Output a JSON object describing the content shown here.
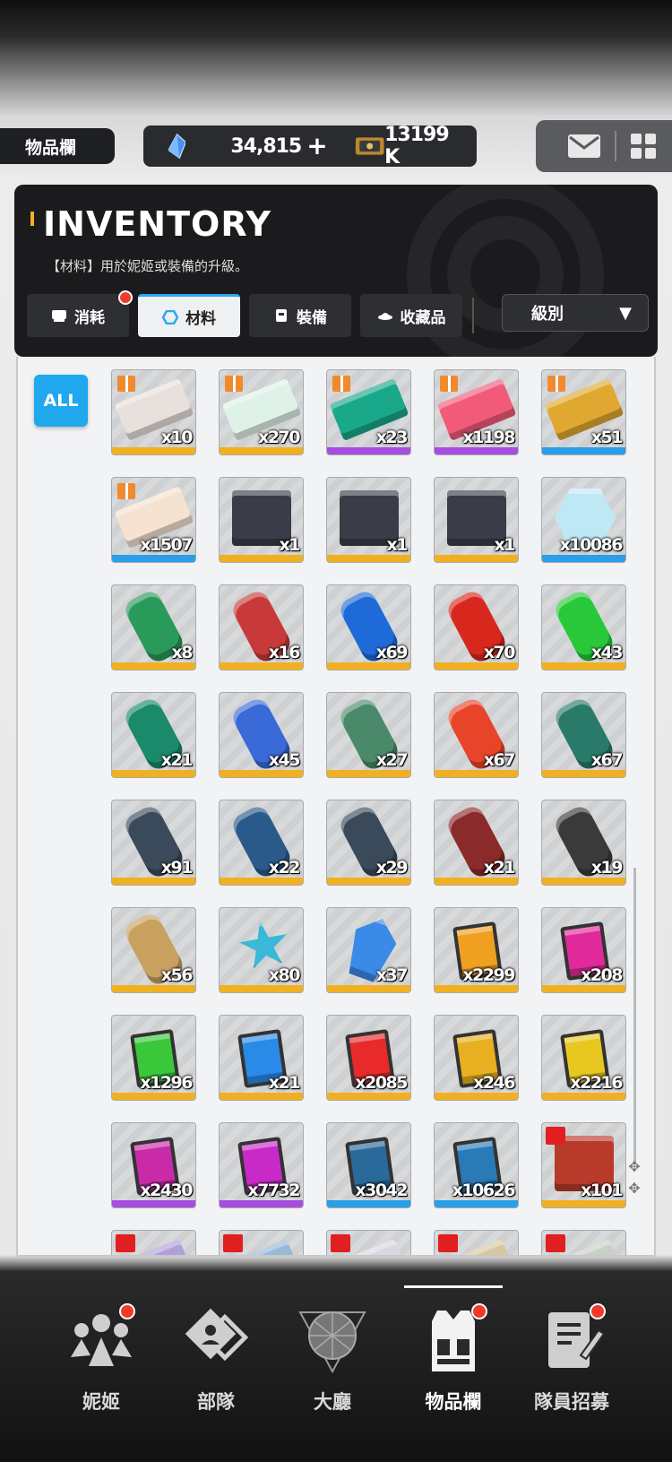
{
  "topbar": {
    "page_tag": "物品欄",
    "gem_value": "34,815",
    "plus_label": "+",
    "ticket_value": "13199 K",
    "icons": [
      "gem-icon",
      "ticket-icon",
      "mail-icon",
      "grid-menu-icon"
    ]
  },
  "header": {
    "title": "INVENTORY",
    "subtitle": "【材料】用於妮姬或裝備的升級。",
    "tabs": [
      {
        "label": "消耗",
        "icon": "consumable-icon",
        "badge": true,
        "active": false
      },
      {
        "label": "材料",
        "icon": "hexagon-icon",
        "badge": false,
        "active": true
      },
      {
        "label": "裝備",
        "icon": "armor-icon",
        "badge": false,
        "active": false
      },
      {
        "label": "收藏品",
        "icon": "collection-icon",
        "badge": false,
        "active": false
      }
    ],
    "sort_label": "級別",
    "sort_arrow": "▼"
  },
  "content": {
    "all_label": "ALL",
    "items": [
      {
        "count": "x10",
        "rarity": "#f0b020",
        "art": "ticket",
        "color": "#e8e0dc",
        "gift": true
      },
      {
        "count": "x270",
        "rarity": "#f0b020",
        "art": "ticket",
        "color": "#dff2e8",
        "gift": true
      },
      {
        "count": "x23",
        "rarity": "#a64de0",
        "art": "ticket",
        "color": "#1aa88a",
        "gift": true
      },
      {
        "count": "x1198",
        "rarity": "#a64de0",
        "art": "ticket",
        "color": "#f25a7a",
        "gift": true
      },
      {
        "count": "x51",
        "rarity": "#2a9ee8",
        "art": "ticket",
        "color": "#e0a830",
        "gift": true
      },
      {
        "count": "x1507",
        "rarity": "#2a9ee8",
        "art": "ticket",
        "color": "#f5e2d0",
        "gift": true
      },
      {
        "count": "x1",
        "rarity": "#f0b020",
        "art": "tablet",
        "color": "#3a3d48",
        "gift": false
      },
      {
        "count": "x1",
        "rarity": "#f0b020",
        "art": "tablet",
        "color": "#3a3d48",
        "gift": false
      },
      {
        "count": "x1",
        "rarity": "#f0b020",
        "art": "tablet",
        "color": "#3a3d48",
        "gift": false
      },
      {
        "count": "x10086",
        "rarity": "#2a9ee8",
        "art": "hex",
        "color": "#bfe8f5",
        "gift": false
      },
      {
        "count": "x8",
        "rarity": "#f0b020",
        "art": "can",
        "color": "#2a9a5a",
        "gift": false
      },
      {
        "count": "x16",
        "rarity": "#f0b020",
        "art": "can",
        "color": "#c83a3a",
        "gift": false
      },
      {
        "count": "x69",
        "rarity": "#f0b020",
        "art": "can",
        "color": "#1e6ad8",
        "gift": false
      },
      {
        "count": "x70",
        "rarity": "#f0b020",
        "art": "can",
        "color": "#d8281e",
        "gift": false
      },
      {
        "count": "x43",
        "rarity": "#f0b020",
        "art": "can",
        "color": "#28c83a",
        "gift": false
      },
      {
        "count": "x21",
        "rarity": "#f0b020",
        "art": "can",
        "color": "#1a8a6a",
        "gift": false
      },
      {
        "count": "x45",
        "rarity": "#f0b020",
        "art": "can",
        "color": "#3a6ad8",
        "gift": false
      },
      {
        "count": "x27",
        "rarity": "#f0b020",
        "art": "can",
        "color": "#4a8a6a",
        "gift": false
      },
      {
        "count": "x67",
        "rarity": "#f0b020",
        "art": "can",
        "color": "#e8442a",
        "gift": false
      },
      {
        "count": "x67",
        "rarity": "#f0b020",
        "art": "can",
        "color": "#2a7a6a",
        "gift": false
      },
      {
        "count": "x91",
        "rarity": "#f0b020",
        "art": "can",
        "color": "#3a4a5a",
        "gift": false
      },
      {
        "count": "x22",
        "rarity": "#f0b020",
        "art": "can",
        "color": "#2a5a8a",
        "gift": false
      },
      {
        "count": "x29",
        "rarity": "#f0b020",
        "art": "can",
        "color": "#3a4a5a",
        "gift": false
      },
      {
        "count": "x21",
        "rarity": "#f0b020",
        "art": "can",
        "color": "#8a2a2a",
        "gift": false
      },
      {
        "count": "x19",
        "rarity": "#f0b020",
        "art": "can",
        "color": "#3a3a3a",
        "gift": false
      },
      {
        "count": "x56",
        "rarity": "#f0b020",
        "art": "can",
        "color": "#c8a060",
        "gift": false
      },
      {
        "count": "x80",
        "rarity": "#f0b020",
        "art": "star",
        "color": "#3ab8d8",
        "gift": false
      },
      {
        "count": "x37",
        "rarity": "#f0b020",
        "art": "crystal",
        "color": "#3a8ae8",
        "gift": false
      },
      {
        "count": "x2299",
        "rarity": "#f0b020",
        "art": "card",
        "color": "#f0a020",
        "gift": false
      },
      {
        "count": "x208",
        "rarity": "#f0b020",
        "art": "card",
        "color": "#e02a9a",
        "gift": false
      },
      {
        "count": "x1296",
        "rarity": "#f0b020",
        "art": "card",
        "color": "#3ac83a",
        "gift": false
      },
      {
        "count": "x21",
        "rarity": "#f0b020",
        "art": "card",
        "color": "#2a8ae8",
        "gift": false
      },
      {
        "count": "x2085",
        "rarity": "#f0b020",
        "art": "card",
        "color": "#e82a2a",
        "gift": false
      },
      {
        "count": "x246",
        "rarity": "#f0b020",
        "art": "card",
        "color": "#e8b020",
        "gift": false
      },
      {
        "count": "x2216",
        "rarity": "#f0b020",
        "art": "card",
        "color": "#e8c820",
        "gift": false
      },
      {
        "count": "x2430",
        "rarity": "#a64de0",
        "art": "card",
        "color": "#c82aa8",
        "gift": false
      },
      {
        "count": "x7732",
        "rarity": "#a64de0",
        "art": "card",
        "color": "#c82ac8",
        "gift": false
      },
      {
        "count": "x3042",
        "rarity": "#2a9ee8",
        "art": "card",
        "color": "#2a6a9a",
        "gift": false
      },
      {
        "count": "x10626",
        "rarity": "#2a9ee8",
        "art": "card",
        "color": "#2a7ab8",
        "gift": false
      },
      {
        "count": "x101",
        "rarity": "#f0b020",
        "art": "tablet",
        "color": "#b83a2a",
        "gift": false,
        "box": true
      }
    ],
    "partial_row": [
      {
        "color": "#b0a0d8"
      },
      {
        "color": "#9ab8d8"
      },
      {
        "color": "#d8d8e0"
      },
      {
        "color": "#d8c8a0"
      },
      {
        "color": "#c8d0c8"
      }
    ],
    "side_controls": [
      "✥",
      "✥"
    ]
  },
  "nav": {
    "items": [
      {
        "label": "妮姬",
        "icon": "nikke-icon",
        "badge": true,
        "active": false
      },
      {
        "label": "部隊",
        "icon": "squad-icon",
        "badge": false,
        "active": false
      },
      {
        "label": "大廳",
        "icon": "lobby-icon",
        "badge": false,
        "active": false
      },
      {
        "label": "物品欄",
        "icon": "inventory-icon",
        "badge": true,
        "active": true
      },
      {
        "label": "隊員招募",
        "icon": "recruit-icon",
        "badge": true,
        "active": false
      }
    ]
  }
}
